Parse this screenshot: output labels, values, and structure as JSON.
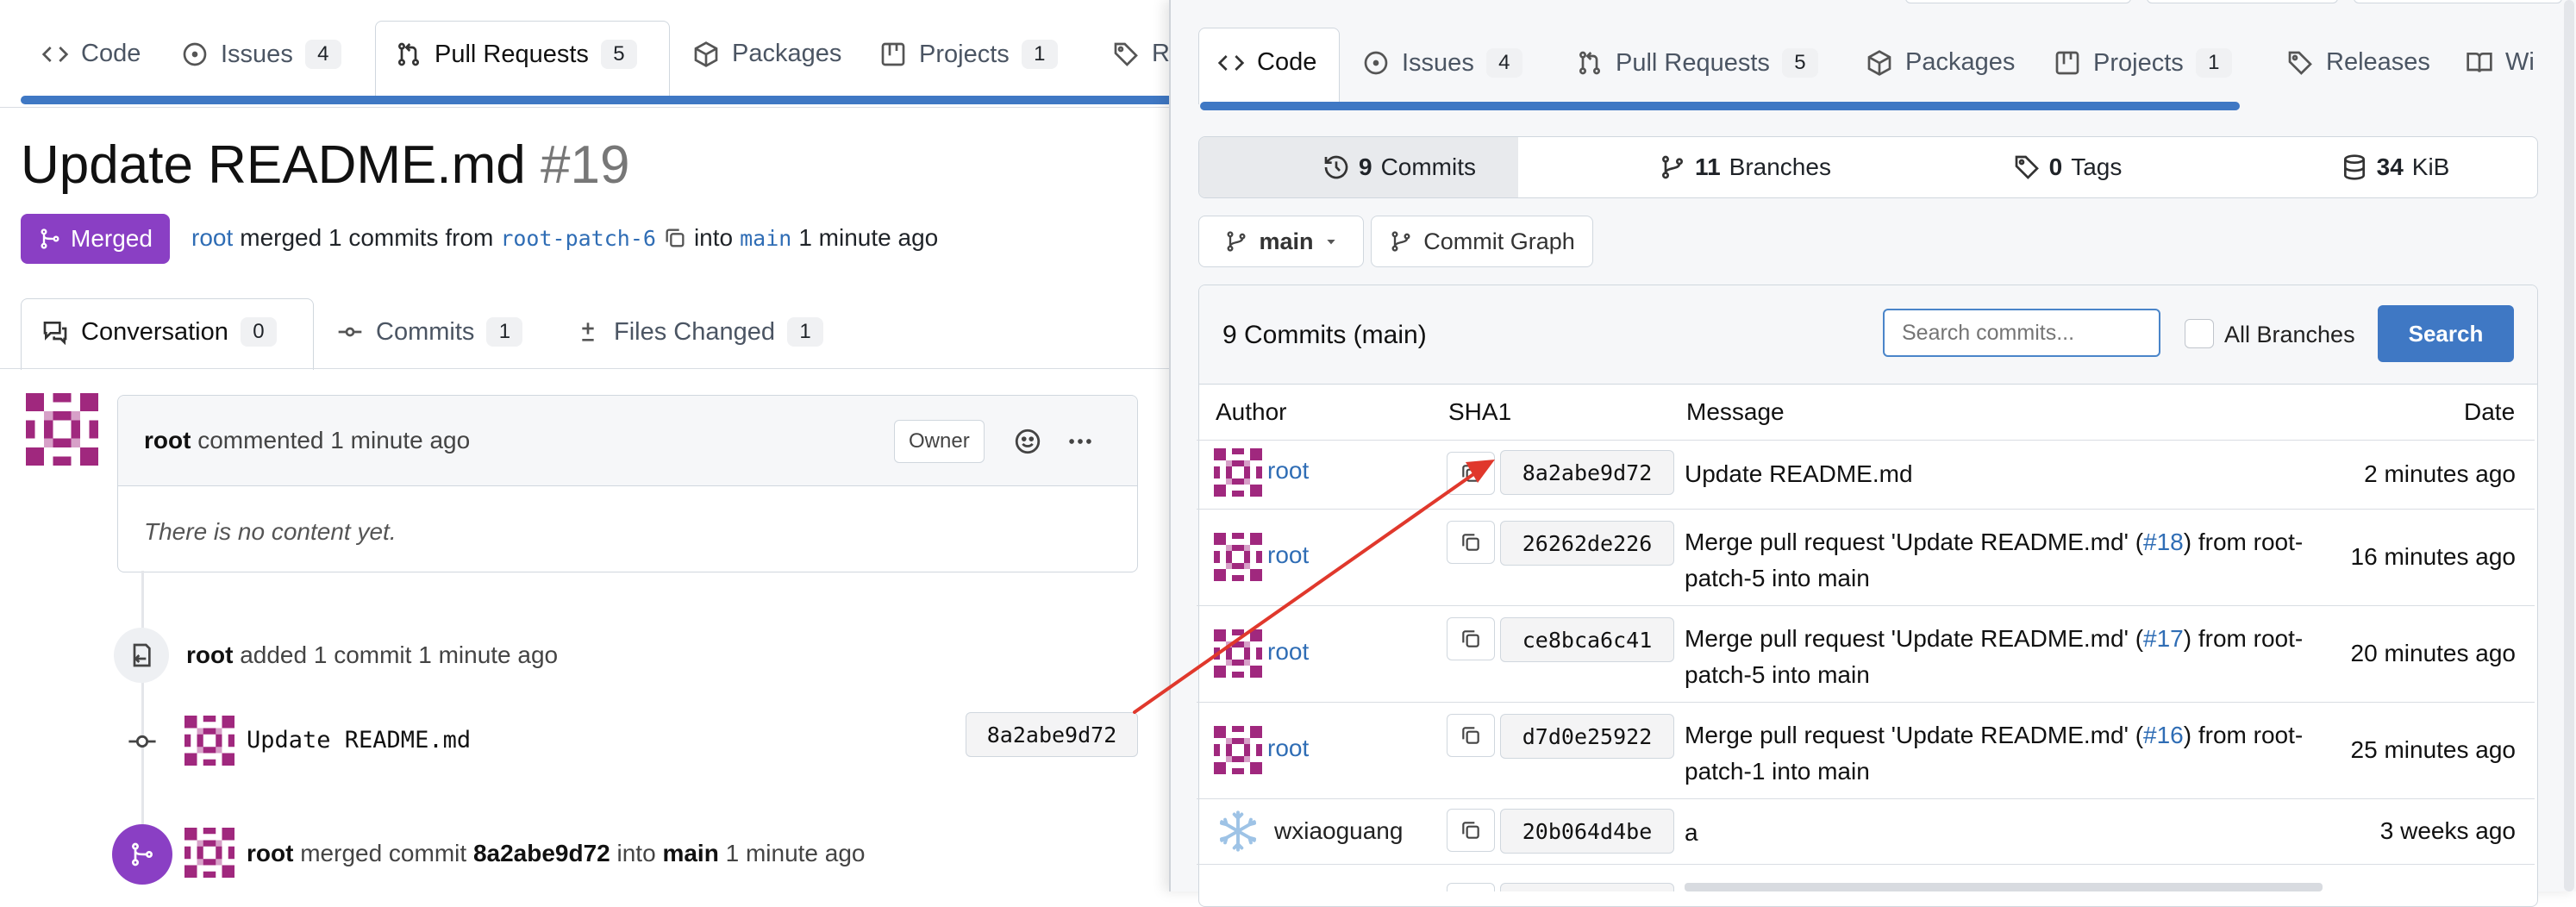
{
  "left": {
    "tabs": [
      {
        "label": "Code",
        "count": ""
      },
      {
        "label": "Issues",
        "count": "4"
      },
      {
        "label": "Pull Requests",
        "count": "5"
      },
      {
        "label": "Packages",
        "count": ""
      },
      {
        "label": "Projects",
        "count": "1"
      },
      {
        "label": "Re",
        "count": ""
      }
    ],
    "pr": {
      "title": "Update README.md",
      "number": "#19",
      "status": "Merged",
      "author": "root",
      "merged_text": "merged 1 commits from",
      "source_branch": "root-patch-6",
      "into_text": "into",
      "target_branch": "main",
      "time": "1 minute ago"
    },
    "subtabs": [
      {
        "label": "Conversation",
        "count": "0"
      },
      {
        "label": "Commits",
        "count": "1"
      },
      {
        "label": "Files Changed",
        "count": "1"
      }
    ],
    "comment": {
      "author": "root",
      "action": "commented",
      "time": "1 minute ago",
      "role": "Owner",
      "body": "There is no content yet."
    },
    "timeline_commit": {
      "author": "root",
      "action": "added 1 commit",
      "time": "1 minute ago",
      "message": "Update README.md",
      "sha": "8a2abe9d72"
    },
    "timeline_merge": {
      "author": "root",
      "action1": "merged commit",
      "sha": "8a2abe9d72",
      "action2": "into",
      "branch": "main",
      "time": "1 minute ago"
    }
  },
  "right": {
    "tabs": [
      {
        "label": "Code",
        "count": ""
      },
      {
        "label": "Issues",
        "count": "4"
      },
      {
        "label": "Pull Requests",
        "count": "5"
      },
      {
        "label": "Packages",
        "count": ""
      },
      {
        "label": "Projects",
        "count": "1"
      },
      {
        "label": "Releases",
        "count": ""
      },
      {
        "label": "Wi",
        "count": ""
      }
    ],
    "stats": [
      {
        "num": "9",
        "label": "Commits"
      },
      {
        "num": "11",
        "label": "Branches"
      },
      {
        "num": "0",
        "label": "Tags"
      },
      {
        "num": "34",
        "label": "KiB"
      }
    ],
    "branch": "main",
    "commit_graph": "Commit Graph",
    "commits_header": "9 Commits (main)",
    "search_placeholder": "Search commits...",
    "all_branches": "All Branches",
    "search_button": "Search",
    "columns": {
      "author": "Author",
      "sha": "SHA1",
      "message": "Message",
      "date": "Date"
    },
    "rows": [
      {
        "author": "root",
        "sha": "8a2abe9d72",
        "msg1": "Update README.md",
        "pr": "",
        "msg2": "",
        "msg3": "",
        "date": "2 minutes ago"
      },
      {
        "author": "root",
        "sha": "26262de226",
        "msg1": "Merge pull request 'Update README.md' (",
        "pr": "#18",
        "msg2": ") from root-",
        "msg3": "patch-5 into main",
        "date": "16 minutes ago"
      },
      {
        "author": "root",
        "sha": "ce8bca6c41",
        "msg1": "Merge pull request 'Update README.md' (",
        "pr": "#17",
        "msg2": ") from root-",
        "msg3": "patch-5 into main",
        "date": "20 minutes ago"
      },
      {
        "author": "root",
        "sha": "d7d0e25922",
        "msg1": "Merge pull request 'Update README.md' (",
        "pr": "#16",
        "msg2": ") from root-",
        "msg3": "patch-1 into main",
        "date": "25 minutes ago"
      },
      {
        "author": "wxiaoguang",
        "sha": "20b064d4be",
        "msg1": "a",
        "pr": "",
        "msg2": "",
        "msg3": "",
        "date": "3 weeks ago"
      }
    ]
  },
  "colors": {
    "merged": "#8a3fc4",
    "accent_blue": "#3f78c4",
    "link": "#2f6db5",
    "arrow": "#e0382c",
    "avatar": "#a0287e"
  }
}
